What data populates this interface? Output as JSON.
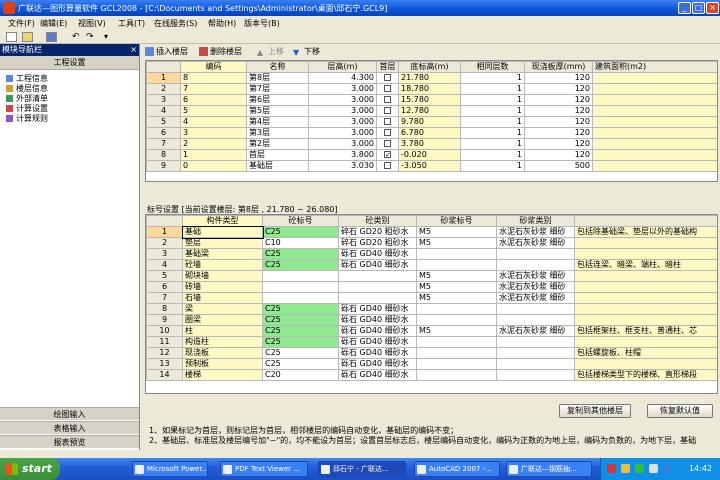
{
  "window": {
    "title": "广联达—图形算量软件 GCL2008 - [C:\\Documents and Settings\\Administrator\\桌面\\邱石宁.GCL9]"
  },
  "menu": [
    "文件(F)",
    "编辑(E)",
    "视图(V)",
    "工具(T)",
    "在线服务(S)",
    "帮助(H)",
    "版本号(B)"
  ],
  "nav": {
    "header": "模块导航栏",
    "close": "×",
    "section": "工程设置",
    "items": [
      "工程信息",
      "楼层信息",
      "外部清单",
      "计算设置",
      "计算规则"
    ],
    "bottom": [
      "绘图输入",
      "表格输入",
      "报表预览"
    ]
  },
  "floor_toolbar": {
    "insert": "插入楼层",
    "delete": "删除楼层",
    "up": "上移",
    "down": "下移"
  },
  "floor_table": {
    "headers": [
      "编码",
      "名称",
      "层高(m)",
      "首层",
      "底标高(m)",
      "相同层数",
      "现浇板厚(mm)",
      "建筑面积(m2)"
    ],
    "rows": [
      {
        "n": "1",
        "code": "8",
        "name": "第8层",
        "height": "4.300",
        "first": false,
        "base": "21.780",
        "same": "1",
        "slab": "120"
      },
      {
        "n": "2",
        "code": "7",
        "name": "第7层",
        "height": "3.000",
        "first": false,
        "base": "18.780",
        "same": "1",
        "slab": "120"
      },
      {
        "n": "3",
        "code": "6",
        "name": "第6层",
        "height": "3.000",
        "first": false,
        "base": "15.780",
        "same": "1",
        "slab": "120"
      },
      {
        "n": "4",
        "code": "5",
        "name": "第5层",
        "height": "3.000",
        "first": false,
        "base": "12.780",
        "same": "1",
        "slab": "120"
      },
      {
        "n": "5",
        "code": "4",
        "name": "第4层",
        "height": "3.000",
        "first": false,
        "base": "9.780",
        "same": "1",
        "slab": "120"
      },
      {
        "n": "6",
        "code": "3",
        "name": "第3层",
        "height": "3.000",
        "first": false,
        "base": "6.780",
        "same": "1",
        "slab": "120"
      },
      {
        "n": "7",
        "code": "2",
        "name": "第2层",
        "height": "3.000",
        "first": false,
        "base": "3.780",
        "same": "1",
        "slab": "120"
      },
      {
        "n": "8",
        "code": "1",
        "name": "首层",
        "height": "3.800",
        "first": true,
        "base": "-0.020",
        "same": "1",
        "slab": "120"
      },
      {
        "n": "9",
        "code": "0",
        "name": "基础层",
        "height": "3.030",
        "first": false,
        "base": "-3.050",
        "same": "1",
        "slab": "500"
      }
    ]
  },
  "label_bar": "标号设置 [当前设置楼层: 第8层 , 21.780 ~ 26.080]",
  "grade_table": {
    "headers": [
      "构件类型",
      "砼标号",
      "砼类别",
      "砂浆标号",
      "砂浆类别",
      "备注"
    ],
    "rows": [
      {
        "n": "1",
        "type": "基础",
        "grade": "C25",
        "cat": "碎石 GD20 粗砂水",
        "mortar": "M5",
        "mcat": "水泥石灰砂浆 细砂",
        "note": "包括除基础梁、垫层以外的基础构"
      },
      {
        "n": "2",
        "type": "垫层",
        "grade": "C10",
        "cat": "碎石 GD20 粗砂水",
        "mortar": "M5",
        "mcat": "水泥石灰砂浆 细砂",
        "note": ""
      },
      {
        "n": "3",
        "type": "基础梁",
        "grade": "C25",
        "cat": "砾石 GD40 细砂水",
        "mortar": "",
        "mcat": "",
        "note": ""
      },
      {
        "n": "4",
        "type": "砼墙",
        "grade": "C25",
        "cat": "砾石 GD40 细砂水",
        "mortar": "",
        "mcat": "",
        "note": "包括连梁、暗梁、端柱、暗柱"
      },
      {
        "n": "5",
        "type": "砌块墙",
        "grade": "",
        "cat": "",
        "mortar": "M5",
        "mcat": "水泥石灰砂浆 细砂",
        "note": ""
      },
      {
        "n": "6",
        "type": "砖墙",
        "grade": "",
        "cat": "",
        "mortar": "M5",
        "mcat": "水泥石灰砂浆 细砂",
        "note": ""
      },
      {
        "n": "7",
        "type": "石墙",
        "grade": "",
        "cat": "",
        "mortar": "M5",
        "mcat": "水泥石灰砂浆 细砂",
        "note": ""
      },
      {
        "n": "8",
        "type": "梁",
        "grade": "C25",
        "cat": "砾石 GD40 细砂水",
        "mortar": "",
        "mcat": "",
        "note": ""
      },
      {
        "n": "9",
        "type": "圈梁",
        "grade": "C25",
        "cat": "砾石 GD40 细砂水",
        "mortar": "",
        "mcat": "",
        "note": ""
      },
      {
        "n": "10",
        "type": "柱",
        "grade": "C25",
        "cat": "砾石 GD40 细砂水",
        "mortar": "M5",
        "mcat": "水泥石灰砂浆 细砂",
        "note": "包括框架柱、框支柱、普通柱、芯"
      },
      {
        "n": "11",
        "type": "构造柱",
        "grade": "C25",
        "cat": "砾石 GD40 细砂水",
        "mortar": "",
        "mcat": "",
        "note": ""
      },
      {
        "n": "12",
        "type": "现浇板",
        "grade": "C25",
        "cat": "砾石 GD40 细砂水",
        "mortar": "",
        "mcat": "",
        "note": "包括螺旋板、柱帽"
      },
      {
        "n": "13",
        "type": "预制板",
        "grade": "C25",
        "cat": "砾石 GD40 细砂水",
        "mortar": "",
        "mcat": "",
        "note": ""
      },
      {
        "n": "14",
        "type": "楼梯",
        "grade": "C20",
        "cat": "砾石 GD40 细砂水",
        "mortar": "",
        "mcat": "",
        "note": "包括楼梯类型下的楼梯、直形梯段"
      }
    ]
  },
  "buttons": {
    "copy": "复制到其他楼层",
    "restore": "恢复默认值"
  },
  "notes": [
    "1、如果标记为首层，则标记层为首层，相邻楼层的编码自动变化，基础层的编码不变；",
    "2、基础层、标准层及楼层编号加\"~\"的，均不能设为首层；设置首层标志后，楼层编码自动变化，编码为正数的为地上层，编码为负数的，为地下层，基础"
  ],
  "taskbar": {
    "start": "start",
    "tasks": [
      "Microsoft Power...",
      "PDF Text Viewer ...",
      "邱石宁 - 广联达...",
      "AutoCAD 2007 -...",
      "广联达—钢筋抽..."
    ],
    "clock": "14:42"
  },
  "colors": {
    "selected_row": "#ffd89a",
    "editable_cell": "#fff9c4",
    "concrete_cell": "#90e890",
    "titlebar": "#0a53d6"
  }
}
